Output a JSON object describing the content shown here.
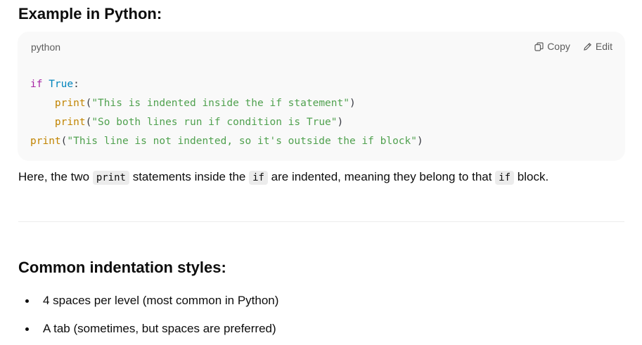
{
  "heading1": "Example in Python:",
  "code_block": {
    "language": "python",
    "copy_label": "Copy",
    "edit_label": "Edit",
    "lines": [
      [
        {
          "t": "if",
          "c": "kw"
        },
        {
          "t": " ",
          "c": "pn"
        },
        {
          "t": "True",
          "c": "bi"
        },
        {
          "t": ":",
          "c": "pn"
        }
      ],
      [
        {
          "t": "    ",
          "c": "pn"
        },
        {
          "t": "print",
          "c": "fn"
        },
        {
          "t": "(",
          "c": "pn"
        },
        {
          "t": "\"This is indented inside the if statement\"",
          "c": "st"
        },
        {
          "t": ")",
          "c": "pn"
        }
      ],
      [
        {
          "t": "    ",
          "c": "pn"
        },
        {
          "t": "print",
          "c": "fn"
        },
        {
          "t": "(",
          "c": "pn"
        },
        {
          "t": "\"So both lines run if condition is True\"",
          "c": "st"
        },
        {
          "t": ")",
          "c": "pn"
        }
      ],
      [
        {
          "t": "print",
          "c": "fn"
        },
        {
          "t": "(",
          "c": "pn"
        },
        {
          "t": "\"This line is not indented, so it's outside the if block\"",
          "c": "st"
        },
        {
          "t": ")",
          "c": "pn"
        }
      ]
    ]
  },
  "paragraph": {
    "p1": "Here, the two ",
    "code1": "print",
    "p2": " statements inside the ",
    "code2": "if",
    "p3": " are indented, meaning they belong to that ",
    "code3": "if",
    "p4": " block."
  },
  "heading2": "Common indentation styles:",
  "bullets": [
    "4 spaces per level (most common in Python)",
    "A tab (sometimes, but spaces are preferred)"
  ],
  "colors": {
    "keyword": "#a626a4",
    "builtin": "#0184bc",
    "function": "#c18401",
    "string": "#50a14f",
    "code_bg": "#f9f9f9",
    "inline_code_bg": "#ececec"
  },
  "icons": {
    "copy": "copy-icon",
    "edit": "edit-pencil-icon"
  }
}
